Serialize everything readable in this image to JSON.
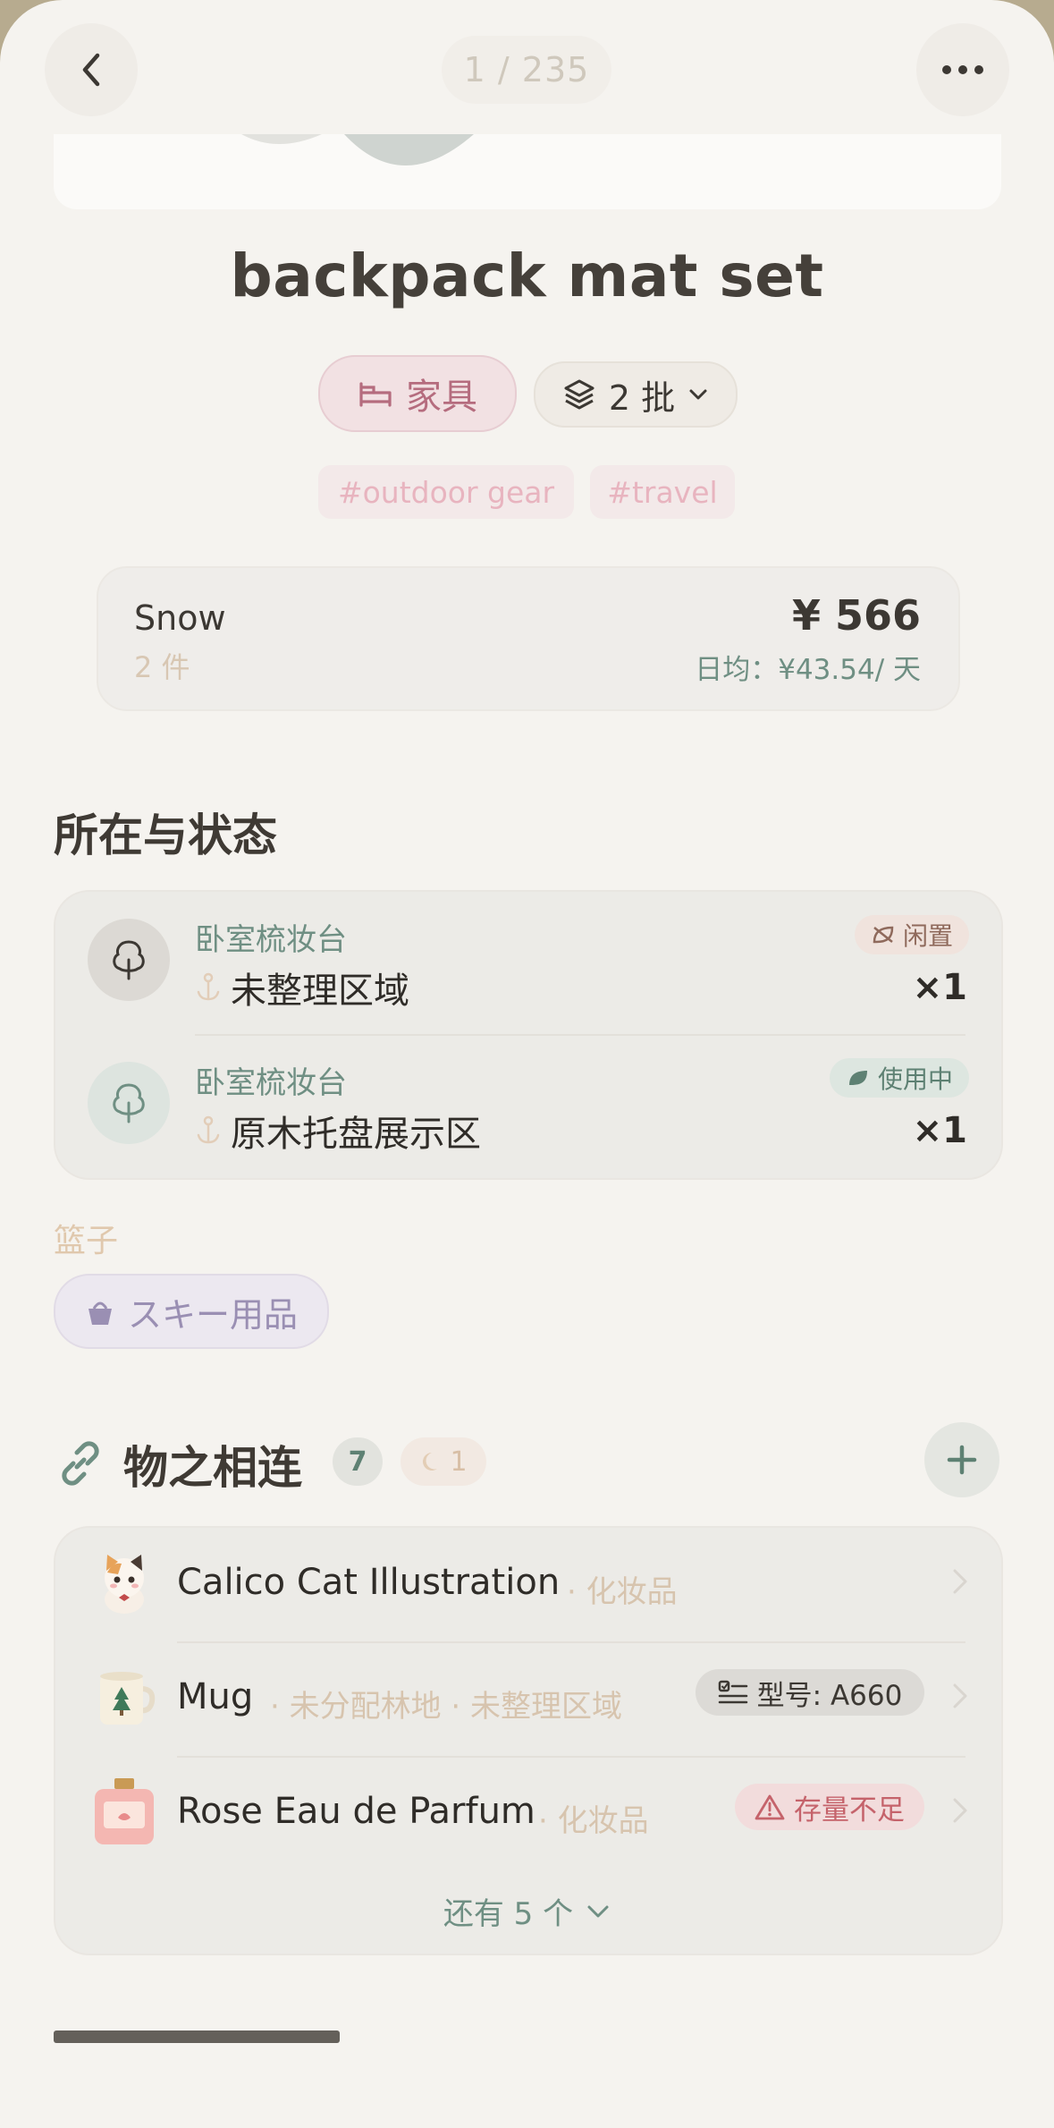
{
  "header": {
    "counter": "1 / 235"
  },
  "item": {
    "title": "backpack mat set",
    "category": "家具",
    "batch": "2 批",
    "tags": [
      "#outdoor gear",
      "#travel"
    ]
  },
  "purchase": {
    "owner": "Snow",
    "quantity": "2 件",
    "price": "¥ 566",
    "daily": "日均：¥43.54/ 天"
  },
  "location_section": {
    "title": "所在与状态",
    "rows": [
      {
        "room": "卧室梳妆台",
        "spot": "未整理区域",
        "status": "闲置",
        "qty": "×1"
      },
      {
        "room": "卧室梳妆台",
        "spot": "原木托盘展示区",
        "status": "使用中",
        "qty": "×1"
      }
    ]
  },
  "basket": {
    "label": "篮子",
    "name": "スキー用品"
  },
  "links_section": {
    "title": "物之相连",
    "count": "7",
    "moon_count": "1",
    "items": [
      {
        "name": "Calico Cat Illustration",
        "sub": "· 化妆品",
        "badge": ""
      },
      {
        "name": "Mug",
        "sub": "· 未分配林地 · 未整理区域",
        "badge": "型号: A660"
      },
      {
        "name": "Rose Eau de Parfum",
        "sub": "· 化妆品",
        "badge": "存量不足"
      }
    ],
    "more": "还有 5 个"
  },
  "colors": {
    "accent_green": "#6f8f83",
    "pink": "#b56c7e",
    "background": "#f5f3ef"
  }
}
